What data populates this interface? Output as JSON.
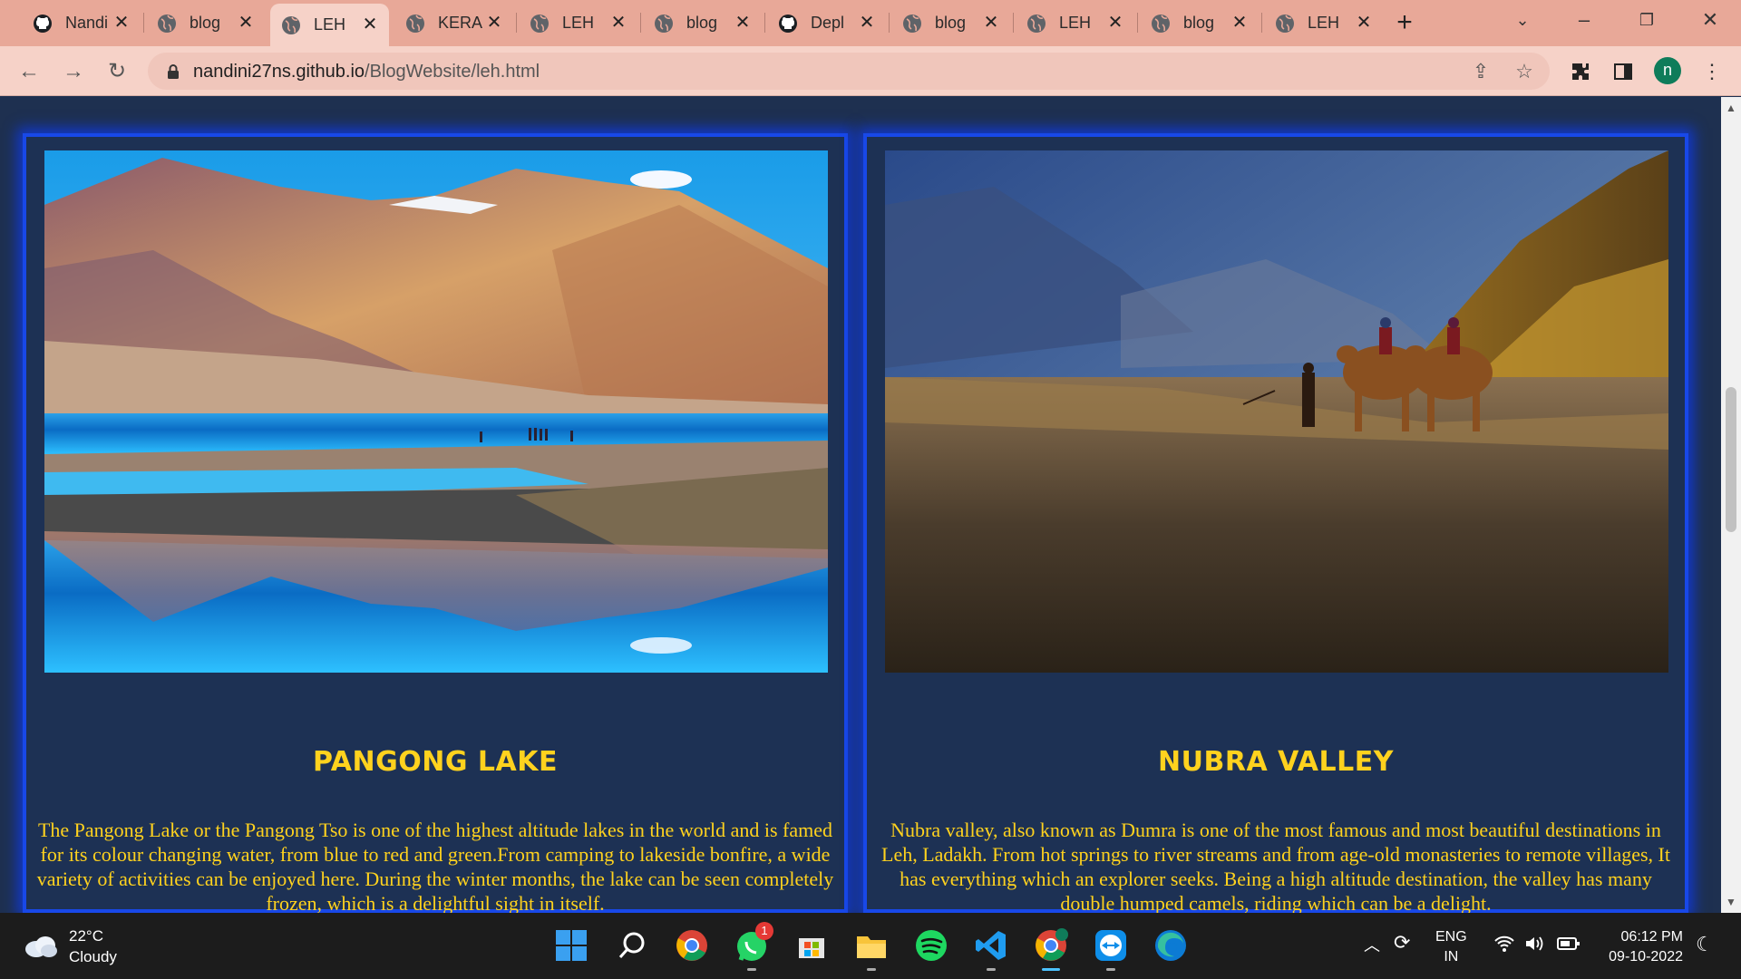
{
  "browser": {
    "tabs": [
      {
        "title": "Nandi",
        "icon": "github-icon",
        "active": false
      },
      {
        "title": "blog",
        "icon": "globe-icon",
        "active": false
      },
      {
        "title": "LEH",
        "icon": "globe-icon",
        "active": true
      },
      {
        "title": "KERA",
        "icon": "globe-icon",
        "active": false
      },
      {
        "title": "LEH",
        "icon": "globe-icon",
        "active": false
      },
      {
        "title": "blog",
        "icon": "globe-icon",
        "active": false
      },
      {
        "title": "Depl",
        "icon": "github-icon",
        "active": false
      },
      {
        "title": "blog",
        "icon": "globe-icon",
        "active": false
      },
      {
        "title": "LEH",
        "icon": "globe-icon",
        "active": false
      },
      {
        "title": "blog",
        "icon": "globe-icon",
        "active": false
      },
      {
        "title": "LEH",
        "icon": "globe-icon",
        "active": false
      }
    ],
    "address": {
      "host": "nandini27ns.github.io",
      "path": "/BlogWebsite/leh.html"
    },
    "profile_initial": "n"
  },
  "page": {
    "cards": [
      {
        "title": "PANGONG LAKE",
        "image": "pangong-lake-photo",
        "text": "The Pangong Lake or the Pangong Tso is one of the highest altitude lakes in the world and is famed for its colour changing water, from blue to red and green.From camping to lakeside bonfire, a wide variety of activities can be enjoyed here. During the winter months, the lake can be seen completely frozen, which is a delightful sight in itself."
      },
      {
        "title": "NUBRA VALLEY",
        "image": "nubra-valley-camels-photo",
        "text": "Nubra valley, also known as Dumra is one of the most famous and most beautiful destinations in Leh, Ladakh. From hot springs to river streams and from age-old monasteries to remote villages, It has everything which an explorer seeks. Being a high altitude destination, the valley has many double humped camels, riding which can be a delight."
      }
    ],
    "colors": {
      "background": "#1e3050",
      "card_glow": "#1238c8",
      "title_text": "#ffd21e"
    }
  },
  "taskbar": {
    "weather": {
      "temp": "22°C",
      "condition": "Cloudy"
    },
    "apps": [
      "windows-start",
      "search",
      "chrome",
      "whatsapp",
      "microsoft-store",
      "file-explorer",
      "spotify",
      "vscode",
      "chrome-profile",
      "teamviewer",
      "edge"
    ],
    "whatsapp_badge": "1",
    "language": {
      "line1": "ENG",
      "line2": "IN"
    },
    "clock": {
      "time": "06:12 PM",
      "date": "09-10-2022"
    }
  }
}
